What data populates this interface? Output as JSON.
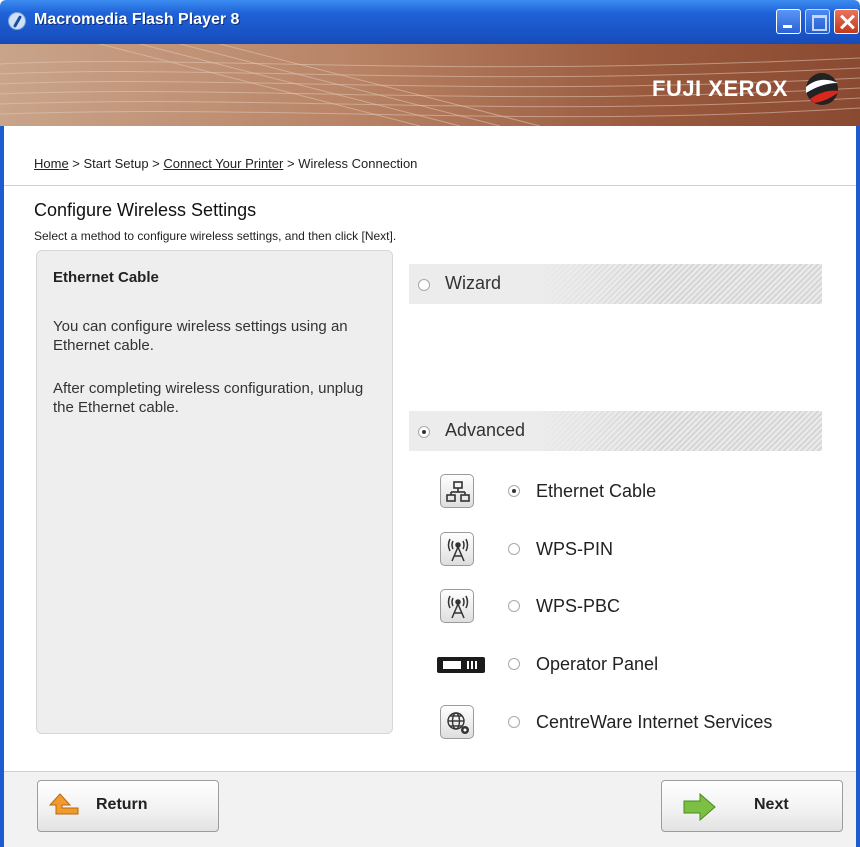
{
  "window": {
    "title": "Macromedia Flash Player 8",
    "buttons": [
      "minimize",
      "maximize",
      "close"
    ]
  },
  "banner": {
    "brand": "FUJI XEROX"
  },
  "breadcrumb": {
    "home": "Home",
    "sep1": " > ",
    "start_setup": "Start Setup",
    "sep2": " > ",
    "connect_printer": "Connect Your Printer",
    "sep3": " > ",
    "current": "Wireless Connection"
  },
  "page": {
    "title": "Configure Wireless Settings",
    "subtitle": "Select a method to configure wireless settings, and then click [Next]."
  },
  "description": {
    "title": "Ethernet Cable",
    "paragraph1": "You can configure wireless settings using an Ethernet cable.",
    "paragraph2": "After completing  wireless configuration, unplug the Ethernet cable."
  },
  "sections": {
    "wizard": {
      "label": "Wizard",
      "selected": false
    },
    "advanced": {
      "label": "Advanced",
      "selected": true
    }
  },
  "options": [
    {
      "label": "Ethernet Cable",
      "icon": "network-icon",
      "selected": true
    },
    {
      "label": "WPS-PIN",
      "icon": "wireless-antenna-icon",
      "selected": false
    },
    {
      "label": "WPS-PBC",
      "icon": "wireless-antenna-icon",
      "selected": false
    },
    {
      "label": "Operator Panel",
      "icon": "operator-panel-icon",
      "selected": false
    },
    {
      "label": "CentreWare Internet Services",
      "icon": "globe-gear-icon",
      "selected": false
    }
  ],
  "footer": {
    "return_label": "Return",
    "next_label": "Next"
  },
  "colors": {
    "titlebar": "#1f62d8",
    "banner": "#b98467",
    "return_arrow": "#f29a2e",
    "next_arrow": "#7bc043"
  }
}
